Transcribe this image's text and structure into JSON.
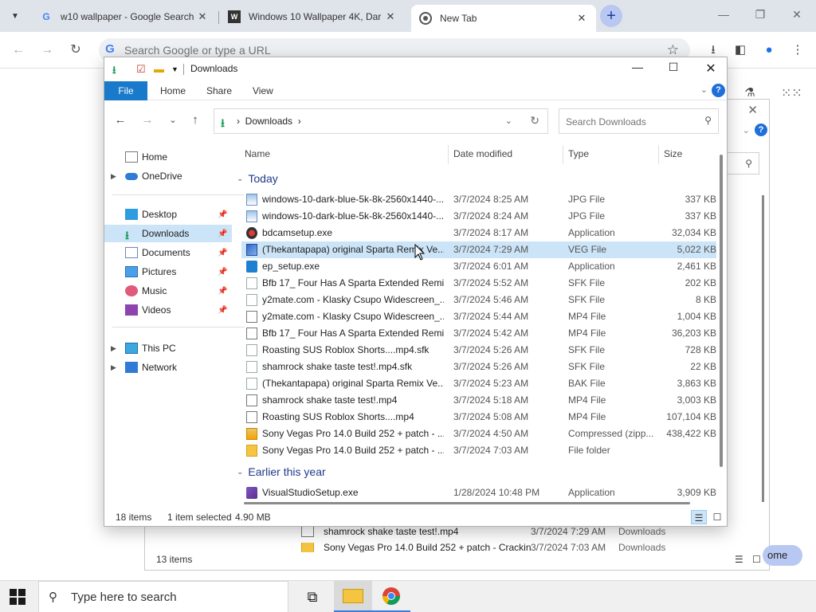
{
  "chrome": {
    "tabs": [
      {
        "title": "w10 wallpaper - Google Search",
        "favicon": "google-icon",
        "active": false
      },
      {
        "title": "Windows 10 Wallpaper 4K, Dar",
        "favicon": "site-icon",
        "active": false
      },
      {
        "title": "New Tab",
        "favicon": "chrome-icon",
        "active": true
      }
    ],
    "omnibox_placeholder": "Search Google or type a URL",
    "accent": "#b9c8f2"
  },
  "background_window": {
    "rows": [
      {
        "name": "shamrock shake taste test!.mp4",
        "date": "3/7/2024 7:29 AM",
        "location": "Downloads"
      },
      {
        "name": "Sony Vegas Pro 14.0 Build 252 + patch - Crackin",
        "date": "3/7/2024 7:03 AM",
        "location": "Downloads"
      }
    ],
    "status": "13 items",
    "home_button": "ome"
  },
  "explorer": {
    "title": "Downloads",
    "ribbon_tabs": [
      "File",
      "Home",
      "Share",
      "View"
    ],
    "breadcrumb": "Downloads",
    "search_placeholder": "Search Downloads",
    "columns": {
      "name": "Name",
      "date": "Date modified",
      "type": "Type",
      "size": "Size"
    },
    "sidebar": [
      {
        "label": "Home",
        "icon": "home-icon",
        "expander": false,
        "pinned": false
      },
      {
        "label": "OneDrive",
        "icon": "onedrive-icon",
        "expander": true,
        "pinned": false
      },
      {
        "label": "Desktop",
        "icon": "desktop-icon",
        "expander": false,
        "pinned": true
      },
      {
        "label": "Downloads",
        "icon": "downloads-icon",
        "expander": false,
        "pinned": true,
        "selected": true
      },
      {
        "label": "Documents",
        "icon": "documents-icon",
        "expander": false,
        "pinned": true
      },
      {
        "label": "Pictures",
        "icon": "pictures-icon",
        "expander": false,
        "pinned": true
      },
      {
        "label": "Music",
        "icon": "music-icon",
        "expander": false,
        "pinned": true
      },
      {
        "label": "Videos",
        "icon": "videos-icon",
        "expander": false,
        "pinned": true
      },
      {
        "label": "This PC",
        "icon": "this-pc-icon",
        "expander": true,
        "pinned": false
      },
      {
        "label": "Network",
        "icon": "network-icon",
        "expander": true,
        "pinned": false
      }
    ],
    "groups": [
      {
        "label": "Today",
        "files": [
          {
            "name": "windows-10-dark-blue-5k-8k-2560x1440-...",
            "date": "3/7/2024 8:25 AM",
            "type": "JPG File",
            "size": "337 KB",
            "icon": "image-file-icon"
          },
          {
            "name": "windows-10-dark-blue-5k-8k-2560x1440-...",
            "date": "3/7/2024 8:24 AM",
            "type": "JPG File",
            "size": "337 KB",
            "icon": "image-file-icon"
          },
          {
            "name": "bdcamsetup.exe",
            "date": "3/7/2024 8:17 AM",
            "type": "Application",
            "size": "32,034 KB",
            "icon": "bandicam-icon"
          },
          {
            "name": "(Thekantapapa) original Sparta Remix Ve...",
            "date": "3/7/2024 7:29 AM",
            "type": "VEG File",
            "size": "5,022 KB",
            "icon": "veg-file-icon",
            "selected": true
          },
          {
            "name": "ep_setup.exe",
            "date": "3/7/2024 6:01 AM",
            "type": "Application",
            "size": "2,461 KB",
            "icon": "app-icon"
          },
          {
            "name": "Bfb 17_ Four Has A Sparta Extended Remi...",
            "date": "3/7/2024 5:52 AM",
            "type": "SFK File",
            "size": "202 KB",
            "icon": "file-icon"
          },
          {
            "name": "y2mate.com - Klasky Csupo Widescreen_...",
            "date": "3/7/2024 5:46 AM",
            "type": "SFK File",
            "size": "8 KB",
            "icon": "file-icon"
          },
          {
            "name": "y2mate.com - Klasky Csupo Widescreen_...",
            "date": "3/7/2024 5:44 AM",
            "type": "MP4 File",
            "size": "1,004 KB",
            "icon": "video-file-icon"
          },
          {
            "name": "Bfb 17_ Four Has A Sparta Extended Remi...",
            "date": "3/7/2024 5:42 AM",
            "type": "MP4 File",
            "size": "36,203 KB",
            "icon": "video-file-icon"
          },
          {
            "name": "Roasting SUS Roblox Shorts....mp4.sfk",
            "date": "3/7/2024 5:26 AM",
            "type": "SFK File",
            "size": "728 KB",
            "icon": "file-icon"
          },
          {
            "name": "shamrock shake taste test!.mp4.sfk",
            "date": "3/7/2024 5:26 AM",
            "type": "SFK File",
            "size": "22 KB",
            "icon": "file-icon"
          },
          {
            "name": "(Thekantapapa) original Sparta Remix Ve...",
            "date": "3/7/2024 5:23 AM",
            "type": "BAK File",
            "size": "3,863 KB",
            "icon": "file-icon"
          },
          {
            "name": "shamrock shake taste test!.mp4",
            "date": "3/7/2024 5:18 AM",
            "type": "MP4 File",
            "size": "3,003 KB",
            "icon": "video-file-icon"
          },
          {
            "name": "Roasting SUS Roblox Shorts....mp4",
            "date": "3/7/2024 5:08 AM",
            "type": "MP4 File",
            "size": "107,104 KB",
            "icon": "video-file-icon"
          },
          {
            "name": "Sony Vegas Pro 14.0 Build 252 + patch - ...",
            "date": "3/7/2024 4:50 AM",
            "type": "Compressed (zipp...",
            "size": "438,422 KB",
            "icon": "zip-icon"
          },
          {
            "name": "Sony Vegas Pro 14.0 Build 252 + patch - ...",
            "date": "3/7/2024 7:03 AM",
            "type": "File folder",
            "size": "",
            "icon": "folder-icon"
          }
        ]
      },
      {
        "label": "Earlier this year",
        "files": [
          {
            "name": "VisualStudioSetup.exe",
            "date": "1/28/2024 10:48 PM",
            "type": "Application",
            "size": "3,909 KB",
            "icon": "visual-studio-icon"
          }
        ]
      }
    ],
    "status": {
      "count": "18 items",
      "selection": "1 item selected",
      "size": "4.90 MB"
    },
    "accent": "#1979ca",
    "selection_color": "#cce4f7"
  },
  "taskbar": {
    "search_placeholder": "Type here to search",
    "items": [
      "task-view-icon",
      "file-explorer-icon",
      "chrome-icon"
    ]
  }
}
